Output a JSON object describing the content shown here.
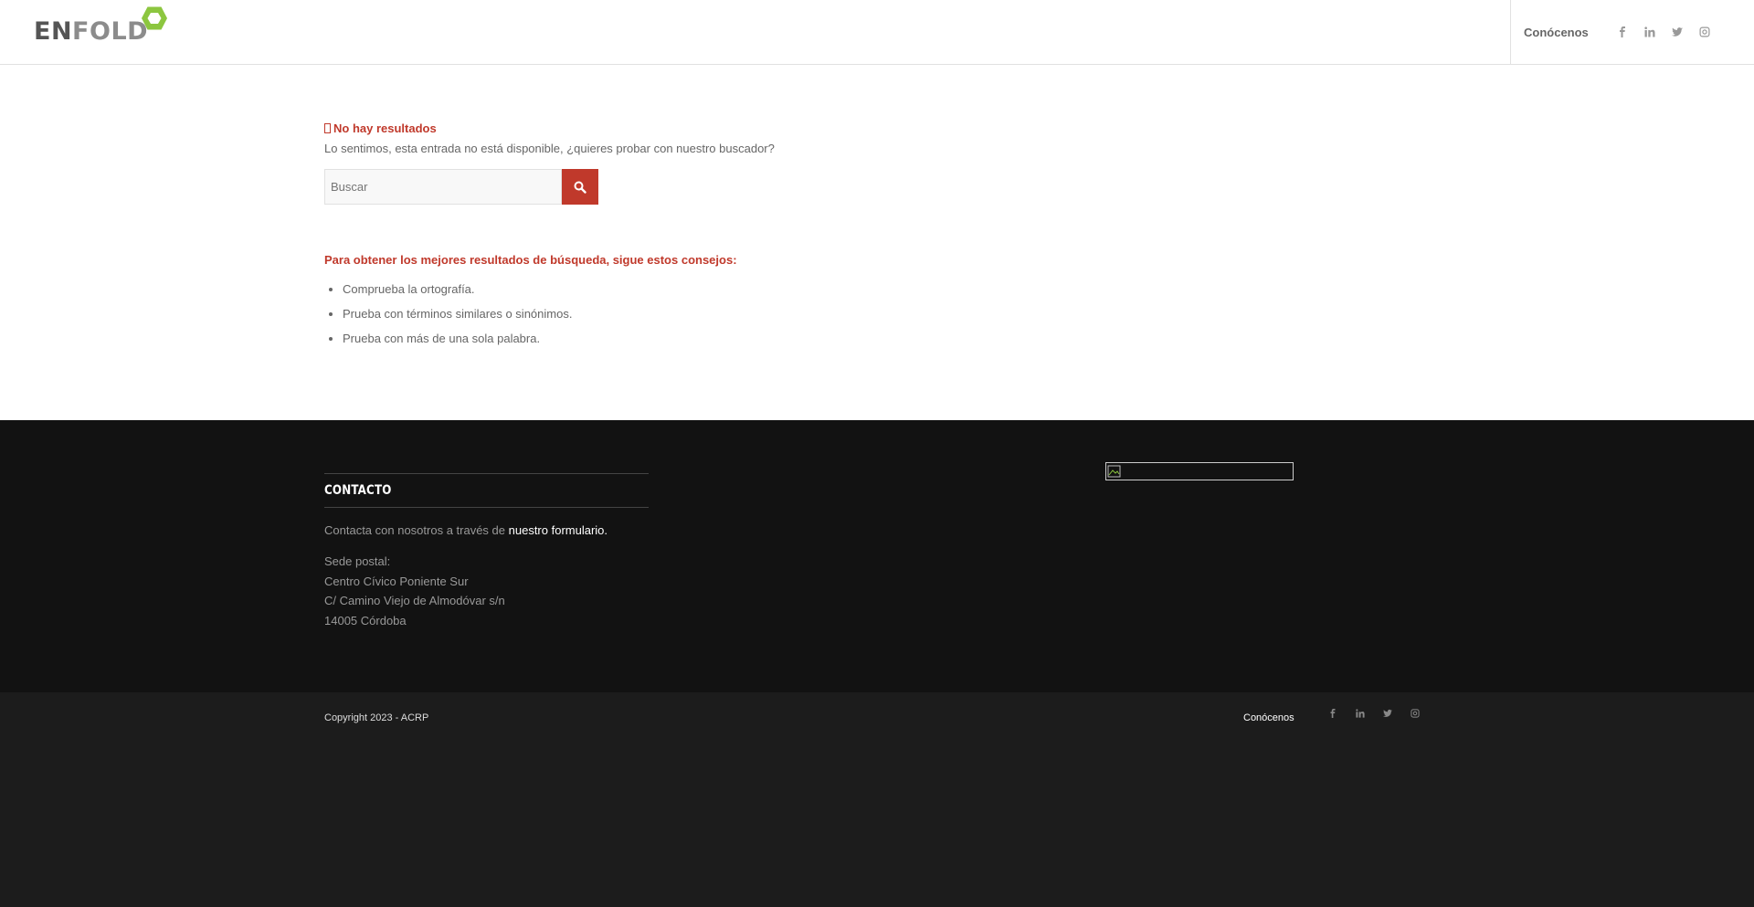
{
  "header": {
    "logo_part1": "EN",
    "logo_part2": "FOLD",
    "nav_item": "Conócenos",
    "social": [
      "facebook-icon",
      "linkedin-icon",
      "twitter-icon",
      "instagram-icon"
    ]
  },
  "main": {
    "no_results_title": "No hay resultados",
    "sorry_text": "Lo sentimos, esta entrada no está disponible, ¿quieres probar con nuestro buscador?",
    "search_placeholder": "Buscar",
    "tips_title": "Para obtener los mejores resultados de búsqueda, sigue estos consejos:",
    "tips": [
      "Comprueba la ortografía.",
      "Prueba con términos similares o sinónimos.",
      "Prueba con más de una sola palabra."
    ]
  },
  "footer": {
    "contact_title": "CONTACTO",
    "contact_text": "Contacta con nosotros a través de ",
    "contact_link": "nuestro formulario.",
    "address": [
      "Sede postal:",
      "Centro Cívico Poniente Sur",
      "C/ Camino Viejo de Almodóvar s/n",
      "14005 Córdoba"
    ]
  },
  "socket": {
    "copyright": "Copyright 2023 - ACRP",
    "nav_item": "Conócenos"
  },
  "colors": {
    "accent": "#c0392b",
    "logo_green": "#8cc63f",
    "footer_bg": "#121212",
    "socket_bg": "#1c1c1c"
  }
}
